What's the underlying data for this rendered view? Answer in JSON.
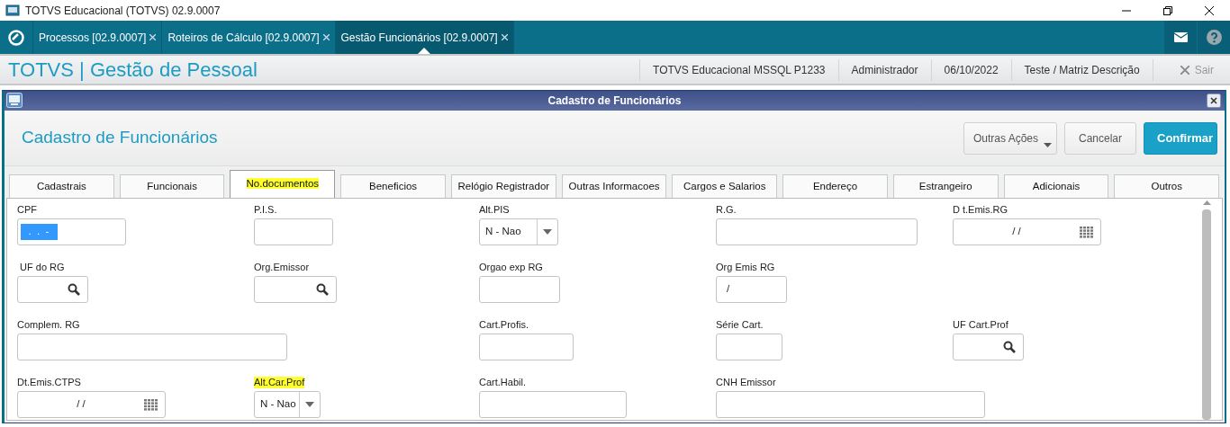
{
  "window": {
    "title": "TOTVS Educacional (TOTVS) 02.9.0007"
  },
  "app_tabs": [
    {
      "label": "Processos [02.9.0007]",
      "selected": false
    },
    {
      "label": "Roteiros de Cálculo [02.9.0007]",
      "selected": false
    },
    {
      "label": "Gestão Funcionários [02.9.0007]",
      "selected": true
    }
  ],
  "app_header": {
    "title": "TOTVS | Gestão de Pessoal",
    "info": [
      "TOTVS Educacional MSSQL P1233",
      "Administrador",
      "06/10/2022",
      "Teste / Matriz Descrição"
    ],
    "exit_label": "Sair"
  },
  "dialog": {
    "title": "Cadastro de Funcionários",
    "heading": "Cadastro de Funcionários",
    "buttons": [
      {
        "label": "Outras Ações",
        "kind": "menu"
      },
      {
        "label": "Cancelar",
        "kind": "secondary"
      },
      {
        "label": "Confirmar",
        "kind": "primary"
      }
    ],
    "tabs": [
      {
        "label": "Cadastrais",
        "selected": false,
        "highlighted": false
      },
      {
        "label": "Funcionais",
        "selected": false,
        "highlighted": false
      },
      {
        "label": "No.documentos",
        "selected": true,
        "highlighted": true
      },
      {
        "label": "Beneficios",
        "selected": false,
        "highlighted": false
      },
      {
        "label": "Relógio Registrador",
        "selected": false,
        "highlighted": false
      },
      {
        "label": "Outras Informacoes",
        "selected": false,
        "highlighted": false
      },
      {
        "label": "Cargos e Salarios",
        "selected": false,
        "highlighted": false
      },
      {
        "label": "Endereço",
        "selected": false,
        "highlighted": false
      },
      {
        "label": "Estrangeiro",
        "selected": false,
        "highlighted": false
      },
      {
        "label": "Adicionais",
        "selected": false,
        "highlighted": false
      },
      {
        "label": "Outros",
        "selected": false,
        "highlighted": false
      }
    ],
    "form_rows": [
      [
        {
          "kind": "text",
          "label": "CPF",
          "value": "  .  .  -",
          "value_selected": true,
          "highlighted": false
        },
        {
          "kind": "text",
          "label": "P.I.S.",
          "highlighted": false
        },
        {
          "kind": "select",
          "label": "Alt.PIS",
          "value": "N - Nao",
          "highlighted": false
        },
        {
          "kind": "text",
          "label": "R.G.",
          "highlighted": false
        },
        {
          "kind": "date",
          "label": "D t.Emis.RG",
          "value": "/ /",
          "highlighted": false
        }
      ],
      [
        {
          "kind": "lookup",
          "label": " UF do RG",
          "highlighted": false
        },
        {
          "kind": "lookup",
          "label": "Org.Emissor",
          "highlighted": false
        },
        {
          "kind": "text",
          "label": "Orgao exp RG",
          "highlighted": false
        },
        {
          "kind": "text",
          "label": "Org Emis RG",
          "value": "/",
          "value_selected": false,
          "highlighted": false
        },
        {
          "kind": "blank"
        }
      ],
      [
        {
          "kind": "text",
          "label": "Complem. RG",
          "highlighted": false
        },
        {
          "kind": "blank"
        },
        {
          "kind": "text",
          "label": "Cart.Profis.",
          "highlighted": false
        },
        {
          "kind": "text",
          "label": "Série Cart.",
          "highlighted": false
        },
        {
          "kind": "lookup",
          "label": "UF Cart.Prof",
          "highlighted": false
        }
      ],
      [
        {
          "kind": "date",
          "label": "Dt.Emis.CTPS",
          "value": "/ /",
          "highlighted": false
        },
        {
          "kind": "select",
          "label": "Alt.Car.Prof",
          "value": "N - Nao",
          "highlighted": true
        },
        {
          "kind": "text",
          "label": "Cart.Habil.",
          "highlighted": false
        },
        {
          "kind": "text",
          "label": "CNH Emissor",
          "highlighted": false
        },
        {
          "kind": "blank"
        }
      ]
    ]
  }
}
